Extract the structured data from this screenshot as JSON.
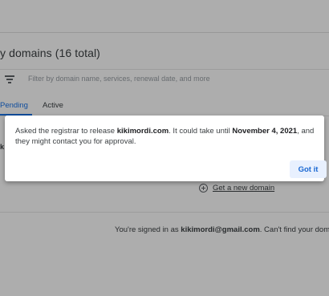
{
  "header": {
    "title": "y domains (16 total)"
  },
  "filter": {
    "placeholder": "Filter by domain name, services, renewal date, and more"
  },
  "tabs": [
    {
      "label": "Pending",
      "selected": true
    },
    {
      "label": "Active",
      "selected": false
    }
  ],
  "list": {
    "fragment": "k"
  },
  "actions": {
    "get_new_domain": "Get a new domain"
  },
  "footer": {
    "prefix": "You're signed in as ",
    "email": "kikimordi@gmail.com",
    "suffix": ". Can't find your domain?"
  },
  "dialog": {
    "part1": "Asked the registrar to release ",
    "domain": "kikimordi.com",
    "part2": ". It could take until ",
    "date": "November 4, 2021",
    "part3": ", and they might contact you for approval.",
    "button_label": "Got it"
  },
  "colors": {
    "accent": "#1a73e8",
    "button_bg": "#e8f0fe",
    "button_text": "#1967d2",
    "scrim": "rgba(0,0,0,0.32)"
  }
}
